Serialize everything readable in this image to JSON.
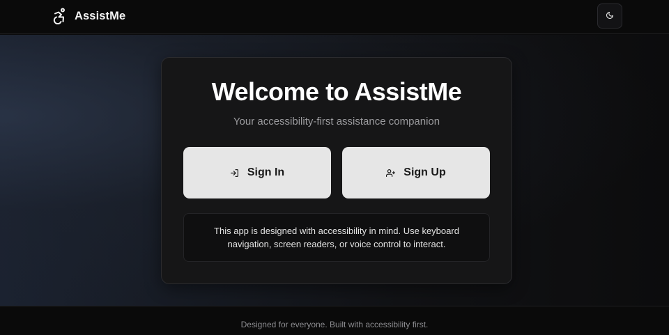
{
  "header": {
    "brand_name": "AssistMe",
    "brand_icon": "accessibility-icon",
    "theme_toggle_icon": "moon-icon"
  },
  "card": {
    "title": "Welcome to AssistMe",
    "subtitle": "Your accessibility-first assistance companion",
    "sign_in": {
      "label": "Sign In",
      "icon": "log-in-icon"
    },
    "sign_up": {
      "label": "Sign Up",
      "icon": "user-plus-icon"
    },
    "notice": "This app is designed with accessibility in mind. Use keyboard navigation, screen readers, or voice control to interact."
  },
  "footer": {
    "text": "Designed for everyone. Built with accessibility first."
  },
  "colors": {
    "background": "#0b0b0c",
    "card": "#161617",
    "button": "#e6e6e6",
    "button_text": "#1a1a1a",
    "muted_text": "#9b9b9e"
  }
}
